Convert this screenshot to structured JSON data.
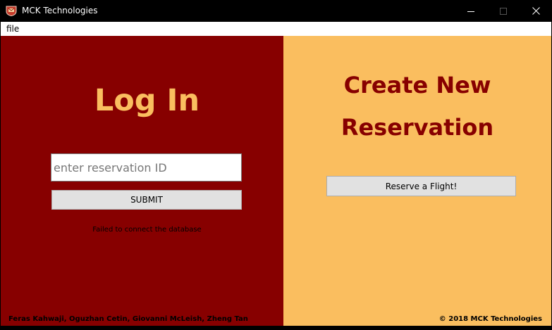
{
  "window": {
    "title": "MCK Technologies",
    "icon": "shield-logo-icon",
    "controls": {
      "minimize": "minimize-icon",
      "maximize": "maximize-icon",
      "close": "close-icon"
    }
  },
  "menu": {
    "file_label": "file"
  },
  "login": {
    "title": "Log In",
    "input_placeholder": "enter reservation ID",
    "input_value": "",
    "submit_label": "SUBMIT",
    "status": "Failed to connect the database",
    "authors": "Feras Kahwaji, Oguzhan Cetin, Giovanni McLeish, Zheng Tan"
  },
  "reservation": {
    "title_line1": "Create New",
    "title_line2": "Reservation",
    "button_label": "Reserve a Flight!",
    "copyright": "© 2018 MCK Technologies"
  },
  "colors": {
    "left_panel": "#870000",
    "right_panel": "#fabe5f",
    "login_title": "#fabe5f",
    "reservation_title": "#870000"
  }
}
